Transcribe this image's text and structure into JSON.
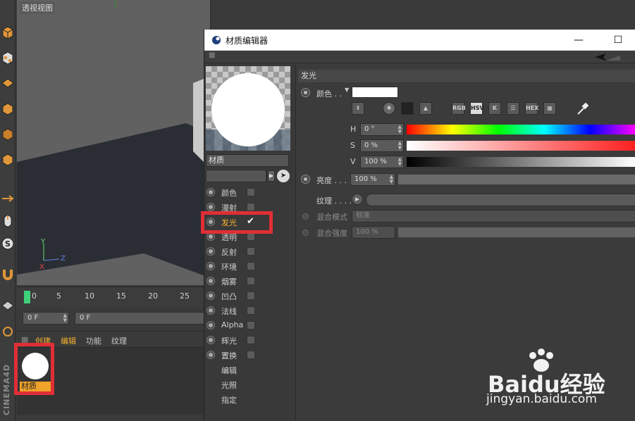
{
  "viewport": {
    "label": "透视视图"
  },
  "brand": "CINEMA4D",
  "timeline": {
    "ticks": [
      "0",
      "5",
      "10",
      "15",
      "20",
      "25"
    ],
    "start_frame": "0 F",
    "current_frame": "0 F"
  },
  "material_manager": {
    "menu": [
      "创建",
      "编辑",
      "功能",
      "纹理"
    ],
    "material_name": "材质"
  },
  "editor": {
    "title": "材质编辑器",
    "material_name": "材质",
    "channels": [
      {
        "label": "颜色",
        "checked": false
      },
      {
        "label": "漫射",
        "checked": false
      },
      {
        "label": "发光",
        "checked": true
      },
      {
        "label": "透明",
        "checked": false
      },
      {
        "label": "反射",
        "checked": false
      },
      {
        "label": "环境",
        "checked": false
      },
      {
        "label": "烟雾",
        "checked": false
      },
      {
        "label": "凹凸",
        "checked": false
      },
      {
        "label": "法线",
        "checked": false
      },
      {
        "label": "Alpha",
        "checked": false
      },
      {
        "label": "辉光",
        "checked": false
      },
      {
        "label": "置换",
        "checked": false
      }
    ],
    "extra_items": [
      "编辑",
      "光照",
      "指定"
    ],
    "checkmark": "✔",
    "section": "发光",
    "color_label": "颜色 . .",
    "color_modes": [
      "RGB",
      "HSV",
      "K",
      "HEX"
    ],
    "h_label": "H",
    "h_value": "0 °",
    "s_label": "S",
    "s_value": "0 %",
    "v_label": "V",
    "v_value": "100 %",
    "brightness_label": "亮度 . . . .",
    "brightness_value": "100 %",
    "texture_label": "纹理 . . . .",
    "blend_mode_label": "混合模式",
    "blend_mode_value": "标准",
    "blend_strength_label": "混合强度",
    "blend_strength_value": "100 %"
  },
  "watermark": {
    "main": "Baidu经验",
    "sub": "jingyan.baidu.com"
  },
  "colors": {
    "accent": "#f5b330",
    "highlight_box": "#e02e36",
    "timeline_cursor": "#3ed17a"
  }
}
